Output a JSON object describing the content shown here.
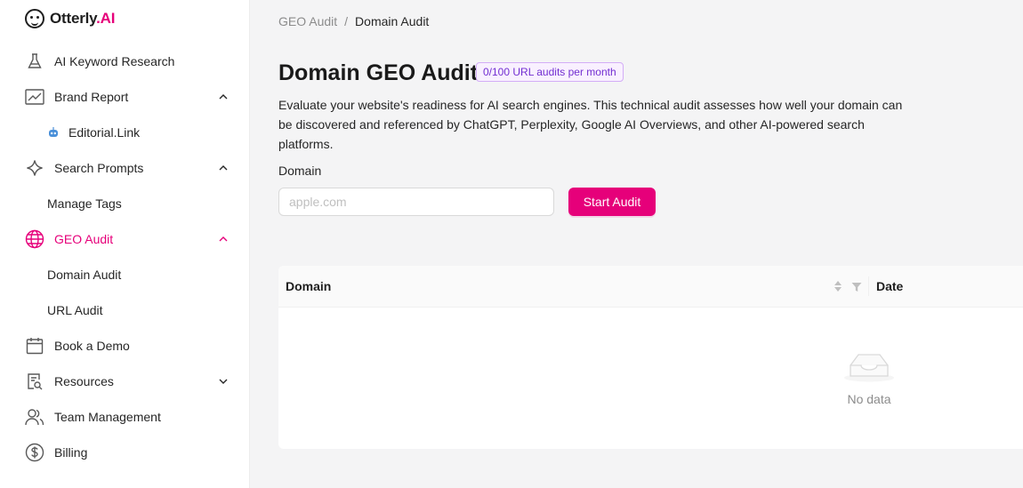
{
  "brand": {
    "name_part1": "Otterly",
    "name_dot": ".",
    "name_part2": "AI",
    "accent": "#e6007a"
  },
  "sidebar": {
    "items": [
      {
        "label": "AI Keyword Research",
        "icon": "flask-icon"
      },
      {
        "label": "Brand Report",
        "icon": "line-chart-icon",
        "chevron": "up"
      },
      {
        "label": "Editorial.Link",
        "icon": "robot-icon"
      },
      {
        "label": "Search Prompts",
        "icon": "sparkle-icon",
        "chevron": "up"
      },
      {
        "label": "Manage Tags"
      },
      {
        "label": "GEO Audit",
        "icon": "globe-icon",
        "chevron": "up",
        "active": true
      },
      {
        "label": "Domain Audit"
      },
      {
        "label": "URL Audit"
      },
      {
        "label": "Book a Demo",
        "icon": "calendar-icon"
      },
      {
        "label": "Resources",
        "icon": "document-search-icon",
        "chevron": "down"
      },
      {
        "label": "Team Management",
        "icon": "users-icon"
      },
      {
        "label": "Billing",
        "icon": "dollar-icon"
      }
    ]
  },
  "breadcrumb": {
    "parent": "GEO Audit",
    "separator": "/",
    "current": "Domain Audit"
  },
  "main": {
    "title": "Domain GEO Audit",
    "quota_badge": "0/100 URL audits per month",
    "description": "Evaluate your website's readiness for AI search engines. This technical audit assesses how well your domain can be discovered and referenced by ChatGPT, Perplexity, Google AI Overviews, and other AI-powered search platforms.",
    "domain_label": "Domain",
    "domain_placeholder": "apple.com",
    "domain_value": "",
    "start_button": "Start Audit"
  },
  "table": {
    "columns": [
      "Domain",
      "Date"
    ],
    "empty_text": "No data"
  }
}
